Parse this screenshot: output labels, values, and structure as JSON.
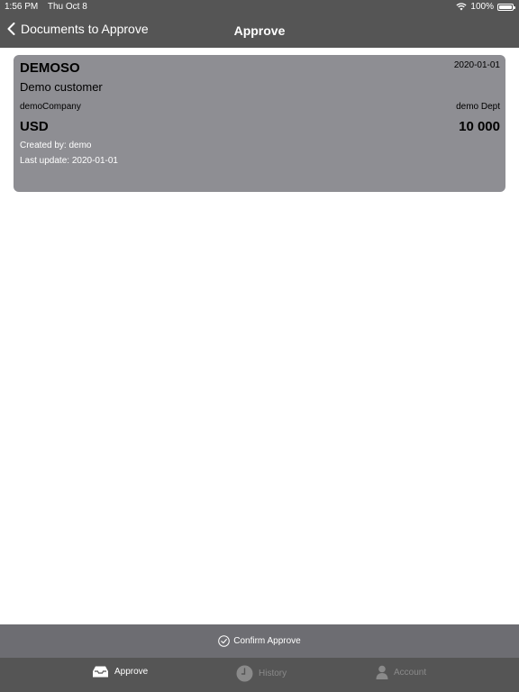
{
  "status_bar": {
    "time": "1:56 PM",
    "date": "Thu Oct 8",
    "battery": "100%",
    "battery_level": 1.0
  },
  "nav": {
    "back_label": "Documents to Approve",
    "title": "Approve"
  },
  "document": {
    "code": "DEMOSO",
    "date": "2020-01-01",
    "customer": "Demo customer",
    "company": "demoCompany",
    "department": "demo Dept",
    "currency": "USD",
    "amount": "10 000",
    "created_by": "Created by: demo",
    "last_update": "Last update: 2020-01-01"
  },
  "confirm_button": {
    "label": "Confirm Approve"
  },
  "tabs": [
    {
      "label": "Approve",
      "icon": "inbox-icon",
      "active": true
    },
    {
      "label": "History",
      "icon": "clock-icon",
      "active": false
    },
    {
      "label": "Account",
      "icon": "person-icon",
      "active": false
    }
  ],
  "colors": {
    "bar": "#555555",
    "card": "#8e8e93",
    "confirm_bar": "#6d6d72",
    "inactive_tab": "#8a8a8a"
  }
}
